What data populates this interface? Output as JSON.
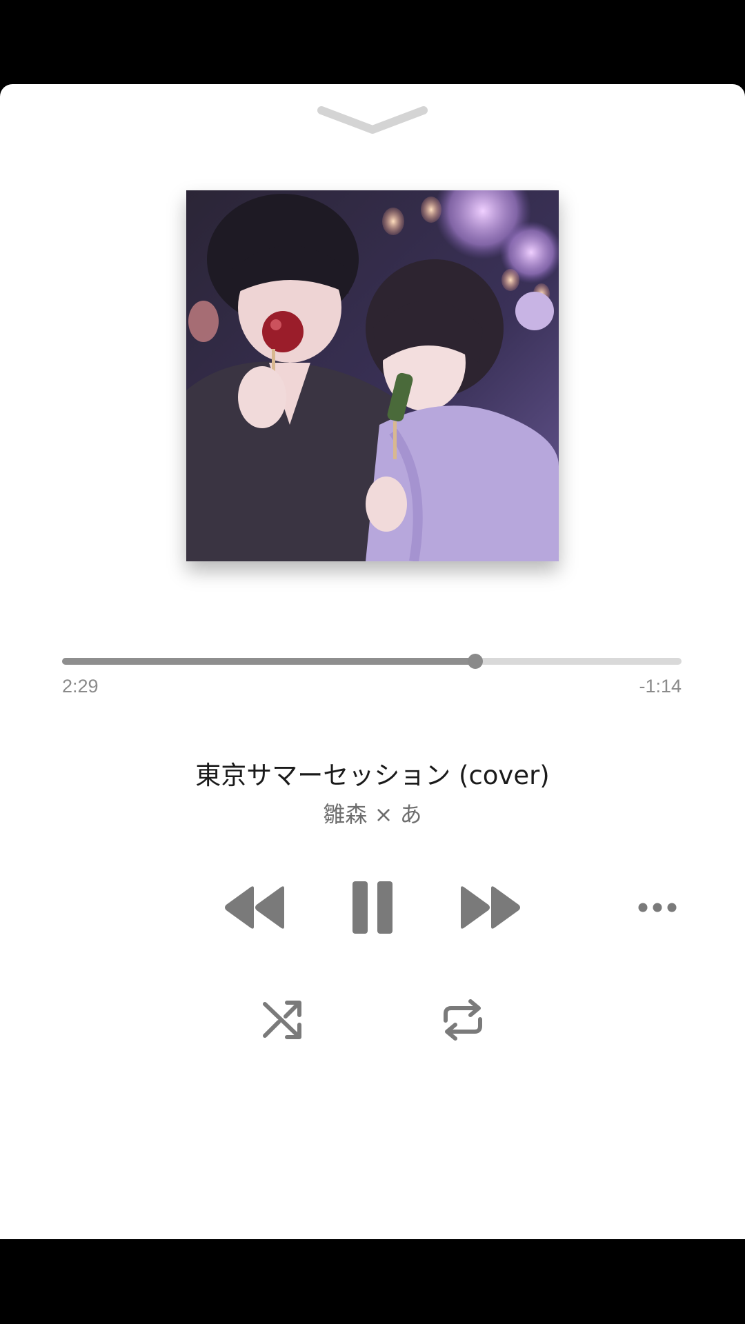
{
  "player": {
    "time_elapsed": "2:29",
    "time_remaining": "-1:14",
    "progress_fraction": 0.667,
    "song_title": "東京サマーセッション (cover)",
    "artist": "雛森 × あ"
  },
  "icons": {
    "dismiss": "chevron-down-icon",
    "rewind": "rewind-icon",
    "pause": "pause-icon",
    "forward": "fast-forward-icon",
    "more": "more-icon",
    "shuffle": "shuffle-icon",
    "repeat": "repeat-icon"
  },
  "colors": {
    "control_gray": "#8a8a8a",
    "track_bg": "#d9d9d9",
    "track_fill": "#8e8e8e",
    "chevron": "#d4d4d4"
  }
}
